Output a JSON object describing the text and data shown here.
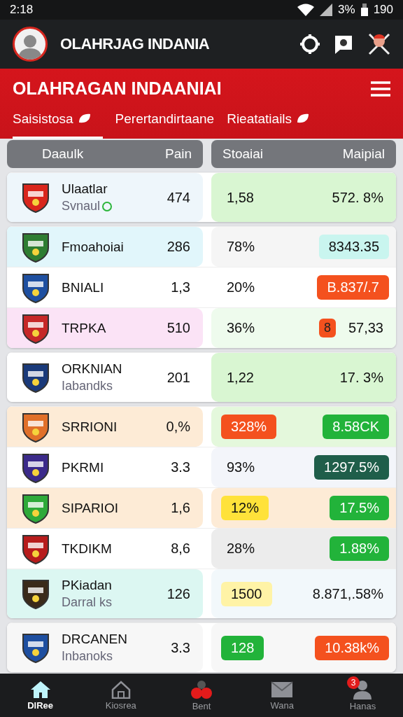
{
  "status_bar": {
    "time": "2:18",
    "battery": "3%",
    "extra": "190"
  },
  "app_bar": {
    "title": "OLAHRJAG INDANIA"
  },
  "header": {
    "title": "OLAHRAGAN INDAANIAI"
  },
  "tabs": [
    {
      "label": "Saisistosa",
      "selected": true,
      "icon": true
    },
    {
      "label": "Perertandirtaane",
      "selected": false,
      "icon": false
    },
    {
      "label": "Rieatatiails",
      "selected": false,
      "icon": true
    }
  ],
  "table": {
    "columns": [
      "Daaulk",
      "Pain",
      "Stoaiai",
      "Maipial"
    ],
    "groups": [
      {
        "rows": [
          {
            "name": "Ulaatlar",
            "sub": "Svnaul",
            "sub_mark": true,
            "points": "474",
            "left": {
              "color": "#eef6fb"
            },
            "right": {
              "color": "#d9f6d2"
            },
            "stat": {
              "text": "1,58"
            },
            "value": {
              "text": "572. 8%"
            },
            "crest": {
              "color": "#d9261c"
            }
          }
        ]
      },
      {
        "rows": [
          {
            "name": "Fmoahoiai",
            "points": "286",
            "left": {
              "color": "#e1f6fb"
            },
            "right": {
              "color": "#f5f5f5"
            },
            "stat": {
              "text": "78%"
            },
            "value": {
              "text": "8343.35",
              "color": "#c9f5ef"
            },
            "crest": {
              "color": "#2e7d32"
            }
          },
          {
            "name": "BNIALI",
            "points": "1,3",
            "left": {
              "color": "#ffffff"
            },
            "right": {
              "color": "#ffffff"
            },
            "stat": {
              "text": "20%"
            },
            "value": {
              "text": "B.837/.7",
              "color": "#f4511e"
            },
            "crest": {
              "color": "#1e4fa0"
            }
          },
          {
            "name": "TRPKA",
            "points": "510",
            "left": {
              "color": "#fbe3f6"
            },
            "right": {
              "color": "#eefbed"
            },
            "stat": {
              "text": "36%"
            },
            "value": {
              "text": "57,33",
              "badge": "8"
            },
            "crest": {
              "color": "#c62828"
            }
          }
        ]
      },
      {
        "rows": [
          {
            "name": "ORKNIAN",
            "sub": "Iabandks",
            "points": "201",
            "left": {
              "color": "#ffffff"
            },
            "right": {
              "color": "#d9f6d2"
            },
            "stat": {
              "text": "1,22"
            },
            "value": {
              "text": "17. 3%"
            },
            "crest": {
              "color": "#1a3a7a"
            }
          }
        ]
      },
      {
        "rows": [
          {
            "name": "SRRIONI",
            "points": "0,%",
            "left": {
              "color": "#fdebd6"
            },
            "right": {
              "color": "#e4f8dc"
            },
            "stat": {
              "text": "328%",
              "color": "#f4511e"
            },
            "value": {
              "text": "8.58CK",
              "color": "#22b33a"
            },
            "crest": {
              "color": "#e0702a"
            }
          },
          {
            "name": "PKRMI",
            "points": "3.3",
            "left": {
              "color": "#ffffff"
            },
            "right": {
              "color": "#f3f5fa"
            },
            "stat": {
              "text": "93%"
            },
            "value": {
              "text": "1297.5%",
              "color": "#1f5e4a"
            },
            "crest": {
              "color": "#3b2a8a"
            }
          },
          {
            "name": "SIPARIOI",
            "points": "1,6",
            "left": {
              "color": "#fdebd6"
            },
            "right": {
              "color": "#fdebd6"
            },
            "stat": {
              "text": "12%",
              "color": "#ffe23a"
            },
            "value": {
              "text": "17.5%",
              "color": "#22b33a"
            },
            "crest": {
              "color": "#2eaa3a"
            }
          },
          {
            "name": "TKDIKM",
            "points": "8,6",
            "left": {
              "color": "#ffffff"
            },
            "right": {
              "color": "#ececec"
            },
            "stat": {
              "text": "28%"
            },
            "value": {
              "text": "1.88%",
              "color": "#22b33a"
            },
            "crest": {
              "color": "#b71c1c"
            }
          },
          {
            "name": "PKiadan",
            "sub": "Darral ks",
            "points": "126",
            "left": {
              "color": "#dcf7f2"
            },
            "right": {
              "color": "#f2f8fb"
            },
            "stat": {
              "text": "1500",
              "color": "#fff3a6"
            },
            "value": {
              "text": "8.871,.58%"
            },
            "crest": {
              "color": "#3a2a1a"
            }
          }
        ]
      },
      {
        "rows": [
          {
            "name": "DRCANEN",
            "sub": "Inbanoks",
            "points": "3.3",
            "left": {
              "color": "#f7f7f7"
            },
            "right": {
              "color": "#f7f7f7"
            },
            "stat": {
              "text": "128",
              "color": "#22b33a"
            },
            "value": {
              "text": "10.38k%",
              "color": "#f4511e"
            },
            "crest": {
              "color": "#1e4fa0"
            }
          }
        ]
      }
    ]
  },
  "nav": [
    {
      "label": "DlRee",
      "selected": true,
      "kind": "home"
    },
    {
      "label": "Kiosrea",
      "selected": false,
      "kind": "house"
    },
    {
      "label": "Bent",
      "selected": false,
      "kind": "dots"
    },
    {
      "label": "Wana",
      "selected": false,
      "kind": "mail"
    },
    {
      "label": "Hanas",
      "selected": false,
      "kind": "person",
      "badge": "3"
    }
  ]
}
